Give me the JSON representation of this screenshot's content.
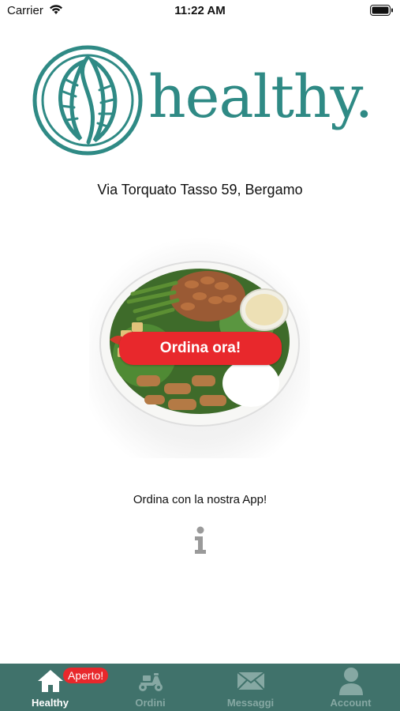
{
  "status_bar": {
    "carrier": "Carrier",
    "time": "11:22 AM",
    "icons": [
      "wifi-icon",
      "battery-icon"
    ]
  },
  "brand": {
    "name": "healthy.",
    "color": "#2f8a85"
  },
  "address": "Via Torquato Tasso 59, Bergamo",
  "order_button": {
    "label": "Ordina ora!",
    "color": "#e8282c"
  },
  "app_text": "Ordina con la nostra App!",
  "info_icon": "info-icon",
  "tab_bar": {
    "background": "#40726b",
    "tabs": [
      {
        "label": "Healthy",
        "icon": "home-icon",
        "active": true,
        "badge": "Aperto!"
      },
      {
        "label": "Ordini",
        "icon": "scooter-icon",
        "active": false
      },
      {
        "label": "Messaggi",
        "icon": "envelope-icon",
        "active": false
      },
      {
        "label": "Account",
        "icon": "user-icon",
        "active": false
      }
    ]
  }
}
